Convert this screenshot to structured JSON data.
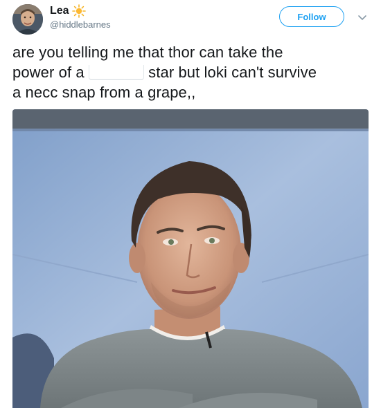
{
  "user": {
    "display_name": "Lea",
    "handle": "@hiddlebarnes",
    "name_emoji": "sun-icon"
  },
  "actions": {
    "follow_label": "Follow",
    "menu_icon": "chevron-down-icon"
  },
  "tweet": {
    "line_1": "are you telling me that thor can take the",
    "line_2a": "power of a",
    "line_2b": "star but loki can't survive",
    "line_3": "a necc snap from a grape,,"
  },
  "media": {
    "alt": "photo of a man in a grey sweater smirking in front of a blue backdrop"
  },
  "colors": {
    "accent": "#1da1f2",
    "text": "#14171a",
    "secondary": "#657786"
  }
}
